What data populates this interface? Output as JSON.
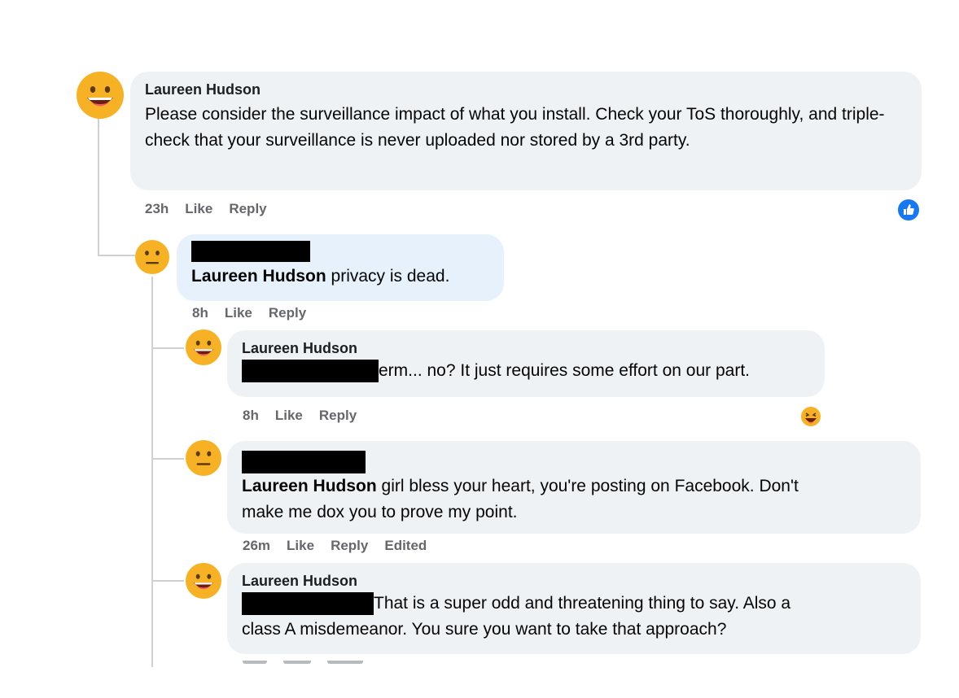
{
  "thread": {
    "comment": {
      "author": "Laureen Hudson",
      "text": "Please consider the surveillance impact of what you install. Check your ToS thoroughly, and triple-check that your surveillance is never uploaded nor stored by a 3rd party.",
      "time": "23h",
      "like_label": "Like",
      "reply_label": "Reply",
      "reaction_icon": "like-reaction-icon"
    },
    "replies": [
      {
        "author_redacted": true,
        "mention": "Laureen Hudson",
        "text": "privacy is dead.",
        "time": "8h",
        "like_label": "Like",
        "reply_label": "Reply"
      },
      {
        "author": "Laureen Hudson",
        "mention_redacted": true,
        "text": "erm... no? It just requires some effort on our part.",
        "time": "8h",
        "like_label": "Like",
        "reply_label": "Reply",
        "reaction_icon": "haha-reaction-icon"
      },
      {
        "author_redacted": true,
        "mention": "Laureen Hudson",
        "text_line1": "girl bless your heart, you're posting on Facebook. Don't",
        "text_line2": "make me dox you to prove my point.",
        "time": "26m",
        "like_label": "Like",
        "reply_label": "Reply",
        "edited_label": "Edited"
      },
      {
        "author": "Laureen Hudson",
        "mention_redacted": true,
        "text_line1": "That is a super odd and threatening thing to say. Also a",
        "text_line2": "class A misdemeanor. You sure you want to take that approach?"
      }
    ]
  },
  "colors": {
    "bubble": "#eff2f5",
    "bubble_highlight": "#e6f1fc",
    "action_text": "#65676b",
    "thread_line": "#ced0d4",
    "like_blue": "#1877f2",
    "avatar": "#f7b125"
  }
}
